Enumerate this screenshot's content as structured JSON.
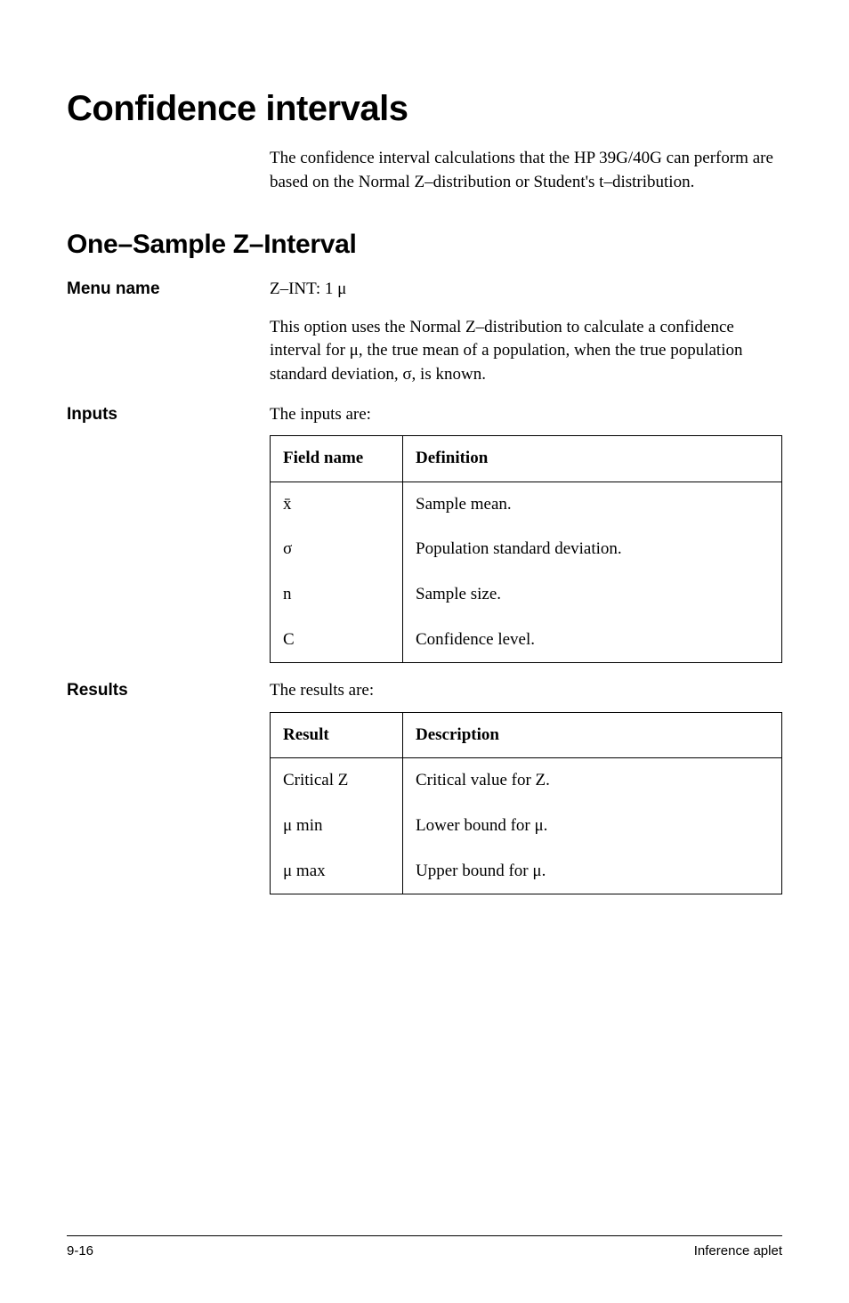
{
  "title": "Confidence intervals",
  "intro": "The confidence interval calculations that the HP 39G/40G can perform are based on the Normal Z–distribution or Student's t–distribution.",
  "subtitle": "One–Sample Z–Interval",
  "menu": {
    "label": "Menu name",
    "value": "Z–INT: 1 μ",
    "description": "This option uses the Normal Z–distribution to calculate a confidence interval for μ, the true mean of a population, when the true population standard deviation, σ, is known."
  },
  "inputs": {
    "label": "Inputs",
    "lead": "The inputs are:",
    "headers": {
      "col1": "Field name",
      "col2": "Definition"
    },
    "rows": [
      {
        "name": "x̄",
        "def": "Sample mean."
      },
      {
        "name": "σ",
        "def": "Population standard deviation."
      },
      {
        "name": "n",
        "def": "Sample size."
      },
      {
        "name": "C",
        "def": "Confidence level."
      }
    ]
  },
  "results": {
    "label": "Results",
    "lead": "The results are:",
    "headers": {
      "col1": "Result",
      "col2": "Description"
    },
    "rows": [
      {
        "name": "Critical Z",
        "def": "Critical value for Z."
      },
      {
        "name": "μ min",
        "def": "Lower bound for μ."
      },
      {
        "name": "μ max",
        "def": "Upper bound for μ."
      }
    ]
  },
  "footer": {
    "left": "9-16",
    "right": "Inference aplet"
  }
}
